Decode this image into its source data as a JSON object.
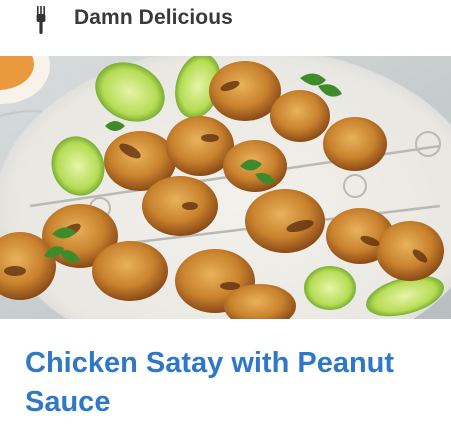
{
  "source": {
    "name": "Damn Delicious",
    "logo_icon": "fork-logo-icon"
  },
  "article": {
    "title": "Chicken Satay with Peanut Sauce",
    "image_icon": "chicken-satay-photo",
    "link_color": "#2f78c8"
  }
}
